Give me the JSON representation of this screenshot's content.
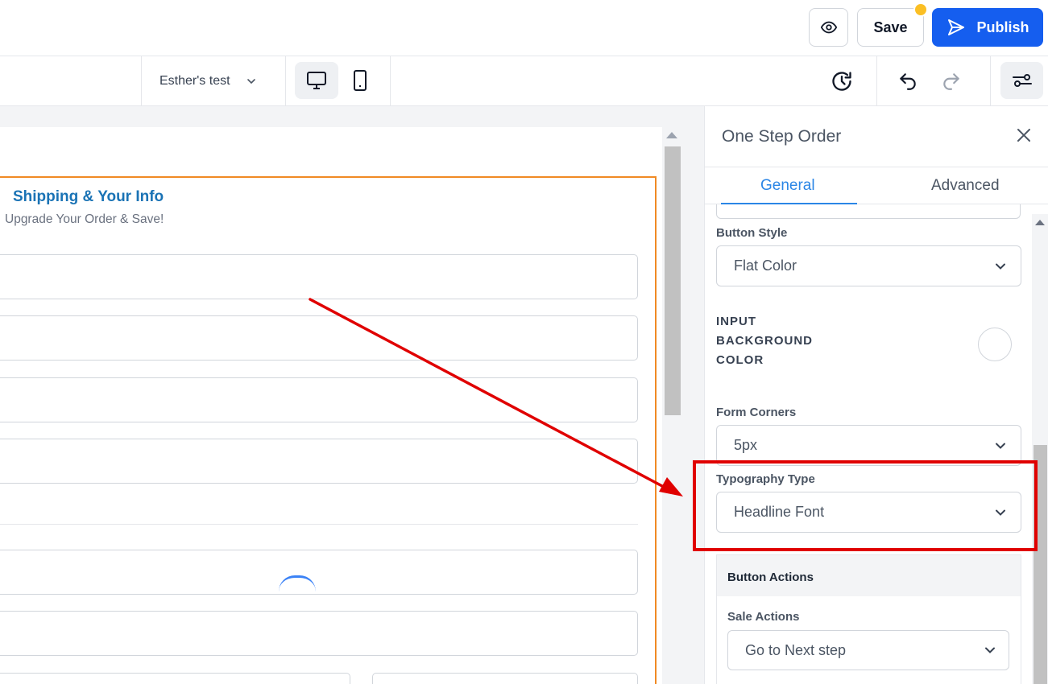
{
  "header": {
    "save_label": "Save",
    "publish_label": "Publish"
  },
  "toolbar": {
    "page_name": "Esther's test"
  },
  "canvas": {
    "form_title": "Shipping & Your Info",
    "form_subtitle": "Upgrade Your Order & Save!"
  },
  "panel": {
    "title": "One Step Order",
    "tabs": [
      {
        "label": "General",
        "active": true
      },
      {
        "label": "Advanced",
        "active": false
      }
    ],
    "button_style": {
      "label": "Button Style",
      "value": "Flat Color"
    },
    "input_bg": {
      "label": "INPUT BACKGROUND COLOR",
      "color": "#ffffff"
    },
    "form_corners": {
      "label": "Form Corners",
      "value": "5px"
    },
    "typography": {
      "label": "Typography Type",
      "value": "Headline Font"
    },
    "button_actions": {
      "title": "Button Actions",
      "sale_actions_label": "Sale Actions",
      "sale_actions_value": "Go to Next step"
    }
  },
  "colors": {
    "accent": "#155eef",
    "tab_active": "#2b86e6",
    "form_border": "#f08a24",
    "form_title": "#1a73b5",
    "annotation": "#e00000",
    "notification_dot": "#fbbf24"
  },
  "icons": {
    "preview": "eye-icon",
    "publish": "send-icon",
    "page_dropdown": "chevron-down-icon",
    "desktop": "desktop-icon",
    "mobile": "mobile-icon",
    "history": "history-icon",
    "undo": "undo-icon",
    "redo": "redo-icon",
    "settings": "sliders-icon",
    "close": "close-icon"
  }
}
